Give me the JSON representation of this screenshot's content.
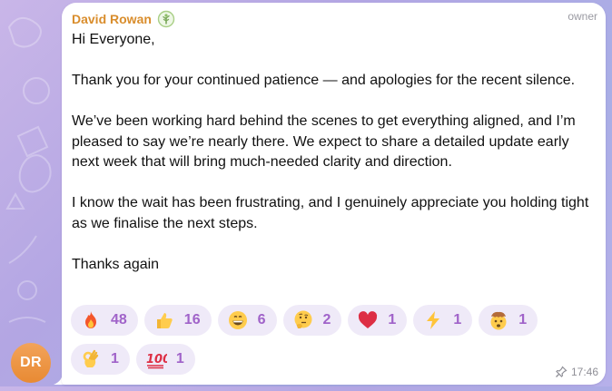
{
  "message": {
    "sender_name": "David Rowan",
    "sender_initials": "DR",
    "role": "owner",
    "paragraphs": [
      "Hi Everyone,",
      "Thank you for your continued patience — and apologies for the recent silence.",
      "We’ve been working hard behind the scenes to get everything aligned, and I’m pleased to say we’re nearly there. We expect to share a detailed update early next week that will bring much-needed clarity and direction.",
      "I know the wait has been frustrating, and I genuinely appreciate you holding tight as we finalise the next steps.",
      "Thanks again"
    ],
    "time": "17:46",
    "pinned": true
  },
  "reactions": [
    {
      "emoji": "fire-emoji",
      "count": "48"
    },
    {
      "emoji": "thumbs-up-emoji",
      "count": "16"
    },
    {
      "emoji": "grinning-face-emoji",
      "count": "6"
    },
    {
      "emoji": "thinking-face-emoji",
      "count": "2"
    },
    {
      "emoji": "red-heart-emoji",
      "count": "1"
    },
    {
      "emoji": "high-voltage-emoji",
      "count": "1"
    },
    {
      "emoji": "exploding-head-emoji",
      "count": "1"
    },
    {
      "emoji": "ok-hand-emoji",
      "count": "1"
    },
    {
      "emoji": "hundred-points-emoji",
      "count": "1"
    }
  ],
  "colors": {
    "sender_name": "#d98d2c",
    "reaction_count": "#a063c9",
    "reaction_bg": "#efeaf8",
    "avatar": "#e88a33"
  }
}
